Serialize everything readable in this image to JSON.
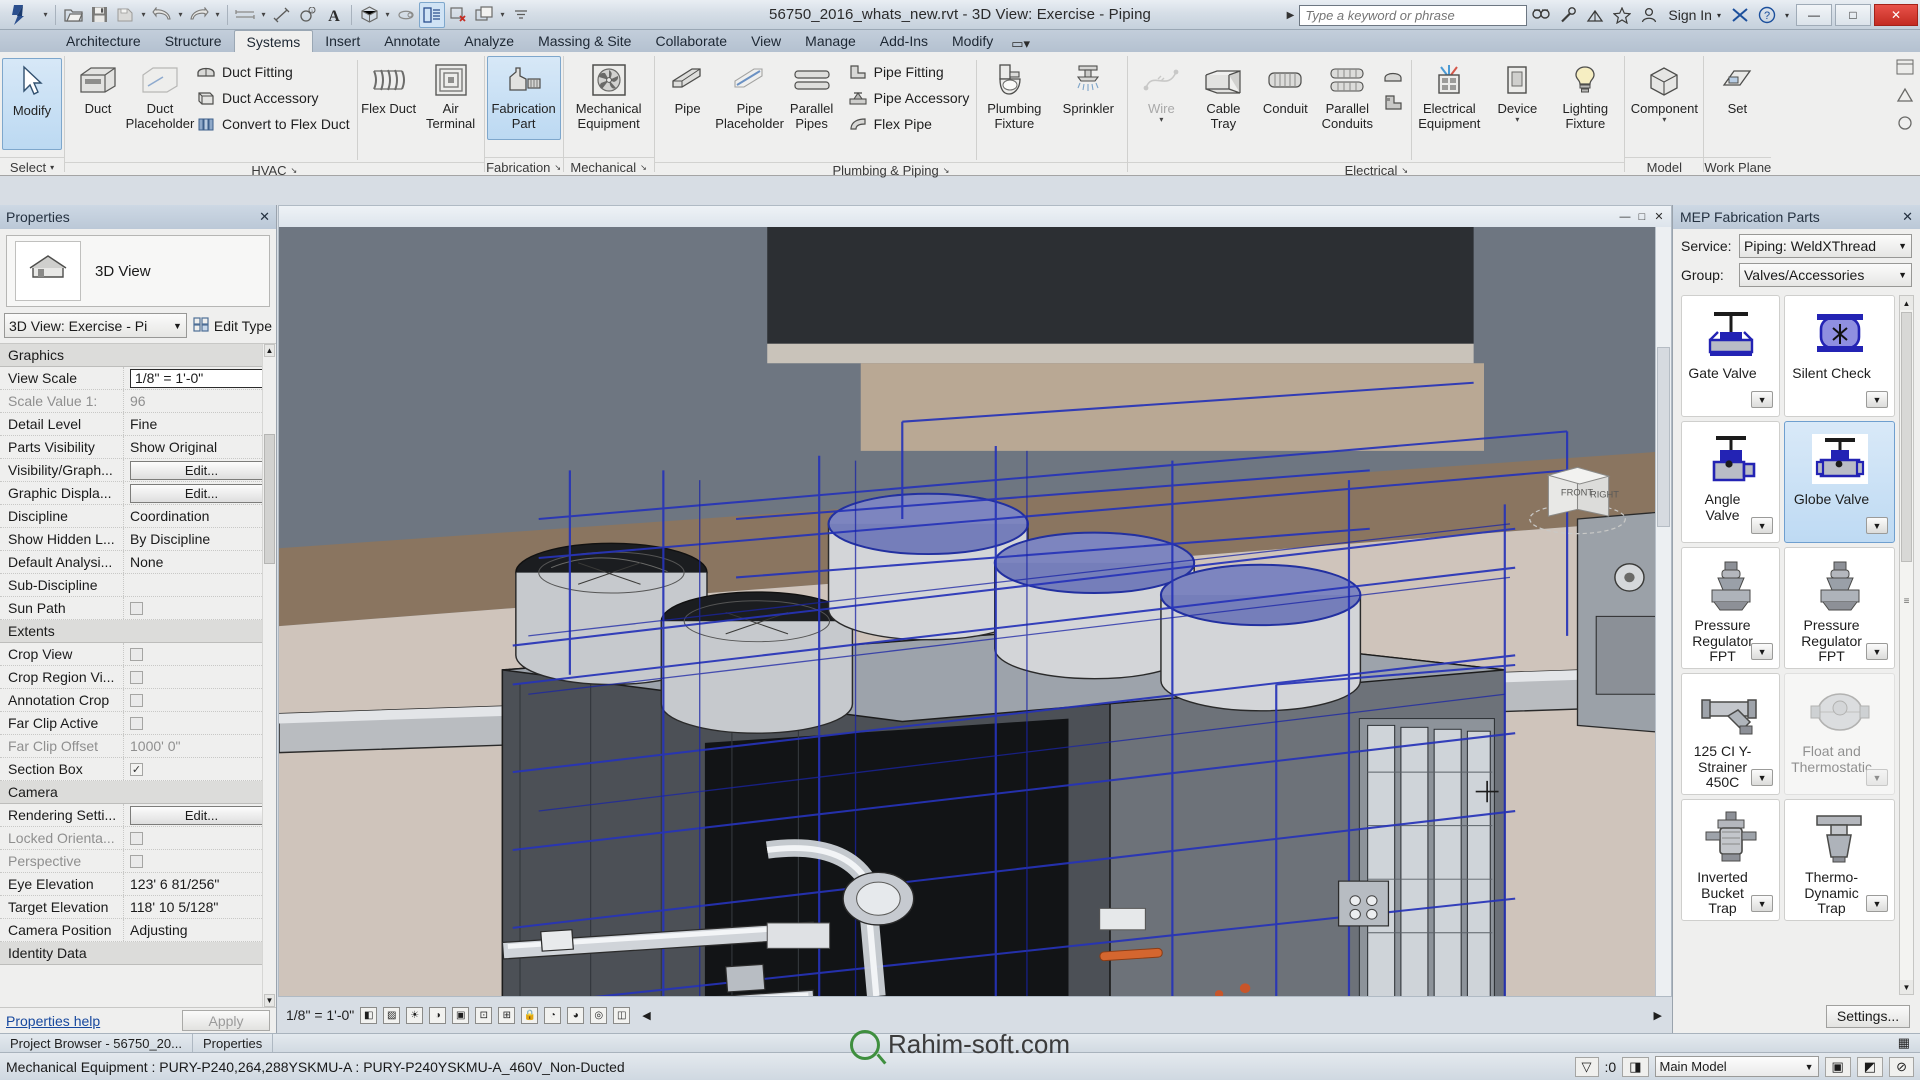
{
  "titlebar": {
    "app_title": "56750_2016_whats_new.rvt - 3D View: Exercise - Piping",
    "search_placeholder": "Type a keyword or phrase",
    "sign_in": "Sign In",
    "qat": [
      {
        "name": "open",
        "icon": "folder-open-icon"
      },
      {
        "name": "save",
        "icon": "save-icon"
      },
      {
        "name": "save-as",
        "icon": "save-as-icon"
      },
      {
        "name": "undo",
        "icon": "undo-icon"
      },
      {
        "name": "redo",
        "icon": "redo-icon"
      },
      {
        "name": "measure",
        "icon": "measure-icon"
      },
      {
        "name": "aligned-dimension",
        "icon": "dimension-icon"
      },
      {
        "name": "tag",
        "icon": "tag-icon"
      },
      {
        "name": "text",
        "icon": "text-icon"
      },
      {
        "name": "default-3d-view",
        "icon": "3d-view-icon"
      },
      {
        "name": "section",
        "icon": "section-icon"
      },
      {
        "name": "thin-lines",
        "icon": "thin-lines-icon"
      },
      {
        "name": "close-hidden-windows",
        "icon": "close-windows-icon"
      },
      {
        "name": "switch-windows",
        "icon": "switch-windows-icon"
      }
    ],
    "win_buttons": {
      "minimize": "—",
      "maximize": "□",
      "close": "✕"
    }
  },
  "ribbon": {
    "tabs": [
      {
        "label": "Architecture",
        "selected": false
      },
      {
        "label": "Structure",
        "selected": false
      },
      {
        "label": "Systems",
        "selected": true
      },
      {
        "label": "Insert",
        "selected": false
      },
      {
        "label": "Annotate",
        "selected": false
      },
      {
        "label": "Analyze",
        "selected": false
      },
      {
        "label": "Massing & Site",
        "selected": false
      },
      {
        "label": "Collaborate",
        "selected": false
      },
      {
        "label": "View",
        "selected": false
      },
      {
        "label": "Manage",
        "selected": false
      },
      {
        "label": "Add-Ins",
        "selected": false
      },
      {
        "label": "Modify",
        "selected": false
      }
    ],
    "select_panel": {
      "modify_label": "Modify",
      "title": "Select"
    },
    "panels": [
      {
        "title": "HVAC",
        "big": [
          {
            "label": "Duct",
            "icon": "duct-icon",
            "disabled": false
          },
          {
            "label": "Duct Placeholder",
            "icon": "duct-placeholder-icon",
            "disabled": false
          }
        ],
        "small": [
          {
            "label": "Duct Fitting",
            "icon": "duct-fitting-icon"
          },
          {
            "label": "Duct Accessory",
            "icon": "duct-accessory-icon"
          },
          {
            "label": "Convert to Flex Duct",
            "icon": "convert-flex-duct-icon"
          }
        ],
        "big2": [
          {
            "label": "Flex Duct",
            "icon": "flex-duct-icon"
          },
          {
            "label": "Air Terminal",
            "icon": "air-terminal-icon"
          }
        ],
        "big3": [
          {
            "label": "Fabrication Part",
            "icon": "fabrication-part-icon",
            "selected": true
          }
        ]
      },
      {
        "title": "Fabrication",
        "big": [
          {
            "label": "Fabrication Part",
            "icon": "fabrication-part-icon",
            "selected": true
          }
        ]
      },
      {
        "title": "Mechanical",
        "big": [
          {
            "label": "Mechanical Equipment",
            "icon": "mechanical-equipment-icon"
          }
        ]
      },
      {
        "title": "Plumbing & Piping",
        "big": [
          {
            "label": "Pipe",
            "icon": "pipe-icon"
          },
          {
            "label": "Pipe Placeholder",
            "icon": "pipe-placeholder-icon"
          },
          {
            "label": "Parallel Pipes",
            "icon": "parallel-pipes-icon"
          }
        ],
        "small": [
          {
            "label": "Pipe Fitting",
            "icon": "pipe-fitting-icon"
          },
          {
            "label": "Pipe Accessory",
            "icon": "pipe-accessory-icon"
          },
          {
            "label": "Flex Pipe",
            "icon": "flex-pipe-icon"
          }
        ],
        "big2": [
          {
            "label": "Plumbing Fixture",
            "icon": "plumbing-fixture-icon"
          },
          {
            "label": "Sprinkler",
            "icon": "sprinkler-icon"
          }
        ]
      },
      {
        "title": "Electrical",
        "big": [
          {
            "label": "Wire",
            "icon": "wire-icon",
            "disabled": true
          },
          {
            "label": "Cable Tray",
            "icon": "cable-tray-icon"
          },
          {
            "label": "Conduit",
            "icon": "conduit-icon"
          },
          {
            "label": "Parallel Conduits",
            "icon": "parallel-conduits-icon"
          }
        ],
        "small": [
          {
            "label": "",
            "icon": "cable-tray-fitting-icon"
          },
          {
            "label": "",
            "icon": "conduit-fitting-icon"
          }
        ],
        "big2": [
          {
            "label": "Electrical Equipment",
            "icon": "electrical-equipment-icon"
          },
          {
            "label": "Device",
            "icon": "device-icon"
          },
          {
            "label": "Lighting Fixture",
            "icon": "lighting-fixture-icon"
          }
        ]
      },
      {
        "title": "Model",
        "big": [
          {
            "label": "Component",
            "icon": "component-icon"
          }
        ]
      },
      {
        "title": "Work Plane",
        "big": [
          {
            "label": "Set",
            "icon": "set-workplane-icon"
          }
        ]
      }
    ]
  },
  "properties": {
    "title": "Properties",
    "type_label": "3D View",
    "selector_value": "3D View: Exercise - Pi",
    "edit_type_label": "Edit Type",
    "rows": [
      {
        "kind": "group",
        "key": "Graphics"
      },
      {
        "kind": "input",
        "key": "View Scale",
        "value": "1/8\" = 1'-0\""
      },
      {
        "kind": "dim",
        "key": "Scale Value   1:",
        "value": "96"
      },
      {
        "kind": "text",
        "key": "Detail Level",
        "value": "Fine"
      },
      {
        "kind": "text",
        "key": "Parts Visibility",
        "value": "Show Original"
      },
      {
        "kind": "button",
        "key": "Visibility/Graph...",
        "value": "Edit..."
      },
      {
        "kind": "button",
        "key": "Graphic Displa...",
        "value": "Edit..."
      },
      {
        "kind": "text",
        "key": "Discipline",
        "value": "Coordination"
      },
      {
        "kind": "text",
        "key": "Show Hidden L...",
        "value": "By Discipline"
      },
      {
        "kind": "text",
        "key": "Default Analysi...",
        "value": "None"
      },
      {
        "kind": "text",
        "key": "Sub-Discipline",
        "value": ""
      },
      {
        "kind": "check",
        "key": "Sun Path",
        "value": "off"
      },
      {
        "kind": "group",
        "key": "Extents"
      },
      {
        "kind": "check",
        "key": "Crop View",
        "value": "off"
      },
      {
        "kind": "check",
        "key": "Crop Region Vi...",
        "value": "off"
      },
      {
        "kind": "check",
        "key": "Annotation Crop",
        "value": "off"
      },
      {
        "kind": "check",
        "key": "Far Clip Active",
        "value": "off"
      },
      {
        "kind": "dim",
        "key": "Far Clip Offset",
        "value": "1000'  0\""
      },
      {
        "kind": "check",
        "key": "Section Box",
        "value": "on"
      },
      {
        "kind": "group",
        "key": "Camera"
      },
      {
        "kind": "button",
        "key": "Rendering Setti...",
        "value": "Edit..."
      },
      {
        "kind": "dimcheck",
        "key": "Locked Orienta...",
        "value": "off"
      },
      {
        "kind": "dimcheck",
        "key": "Perspective",
        "value": "off"
      },
      {
        "kind": "text",
        "key": "Eye Elevation",
        "value": "123'  6 81/256\""
      },
      {
        "kind": "text",
        "key": "Target Elevation",
        "value": "118'  10 5/128\""
      },
      {
        "kind": "text",
        "key": "Camera Position",
        "value": "Adjusting"
      },
      {
        "kind": "group",
        "key": "Identity Data"
      }
    ],
    "help_link": "Properties help",
    "apply_label": "Apply"
  },
  "view": {
    "nav_cube": {
      "front": "FRONT",
      "right": "RIGHT"
    },
    "scale_label": "1/8\" = 1'-0\"",
    "minimize": "—",
    "maximize": "□",
    "close": "✕"
  },
  "mep": {
    "title": "MEP Fabrication Parts",
    "service_label": "Service:",
    "service_value": "Piping: WeldXThread",
    "group_label": "Group:",
    "group_value": "Valves/Accessories",
    "settings_label": "Settings...",
    "parts": [
      {
        "label": "Gate Valve",
        "icon": "gate-valve-icon",
        "selected": false,
        "ghost": false
      },
      {
        "label": "Silent Check",
        "icon": "silent-check-icon",
        "selected": false,
        "ghost": false
      },
      {
        "label": "Angle Valve",
        "icon": "angle-valve-icon",
        "selected": false,
        "ghost": false
      },
      {
        "label": "Globe Valve",
        "icon": "globe-valve-icon",
        "selected": true,
        "ghost": false
      },
      {
        "label": "Pressure Regulator FPT",
        "icon": "pressure-regulator-icon",
        "selected": false,
        "ghost": false
      },
      {
        "label": "Pressure Regulator FPT",
        "icon": "pressure-regulator-icon",
        "selected": false,
        "ghost": false
      },
      {
        "label": "125 CI Y-Strainer 450C",
        "icon": "y-strainer-icon",
        "selected": false,
        "ghost": false
      },
      {
        "label": "Float and Thermostatic",
        "icon": "float-thermostatic-icon",
        "selected": false,
        "ghost": true
      },
      {
        "label": "Inverted Bucket Trap",
        "icon": "inverted-bucket-trap-icon",
        "selected": false,
        "ghost": false
      },
      {
        "label": "Thermo-Dynamic Trap",
        "icon": "thermodynamic-trap-icon",
        "selected": false,
        "ghost": false
      }
    ]
  },
  "bottom": {
    "project_browser_tab": "Project Browser - 56750_20...",
    "properties_tab": "Properties",
    "scale": "1/8\" = 1'-0\"",
    "status_text": "Mechanical Equipment : PURY-P240,264,288YSKMU-A : PURY-P240YSKMU-A_460V_Non-Ducted",
    "selection_count": ":0",
    "model_selector": "Main Model",
    "watermark": "Rahim-soft.com"
  }
}
